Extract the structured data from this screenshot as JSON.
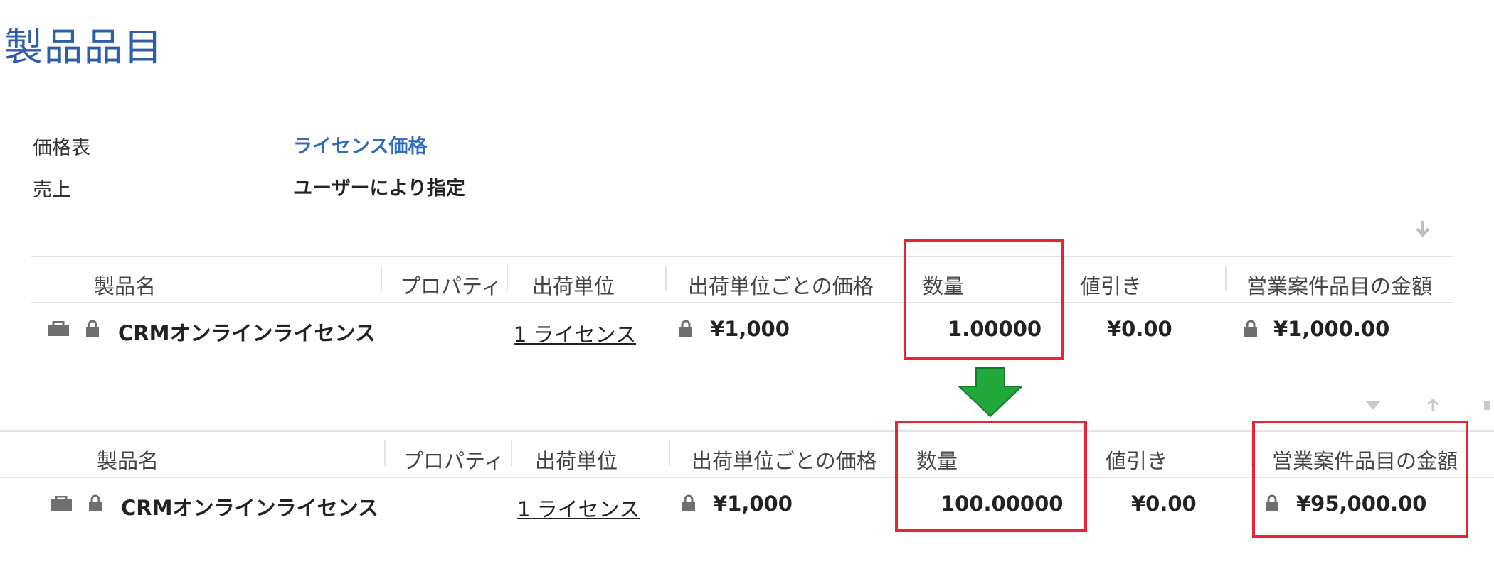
{
  "page": {
    "title": "製品品目"
  },
  "fields": {
    "price_list_label": "価格表",
    "price_list_value": "ライセンス価格",
    "revenue_label": "売上",
    "revenue_value": "ユーザーにより指定"
  },
  "columns": {
    "product_name": "製品名",
    "property": "プロパティ",
    "unit": "出荷単位",
    "price_per_unit": "出荷単位ごとの価格",
    "quantity": "数量",
    "discount": "値引き",
    "amount": "営業案件品目の金額"
  },
  "before": {
    "product_name": "CRMオンラインライセンス",
    "unit": "1 ライセンス",
    "price_per_unit": "¥1,000",
    "quantity": "1.00000",
    "discount": "¥0.00",
    "amount": "¥1,000.00"
  },
  "after": {
    "product_name": "CRMオンラインライセンス",
    "unit": "1 ライセンス",
    "price_per_unit": "¥1,000",
    "quantity": "100.00000",
    "discount": "¥0.00",
    "amount": "¥95,000.00"
  },
  "icons": {
    "product": "product-box-icon",
    "lock": "lock-icon",
    "sort": "sort-arrow-icon",
    "transition_arrow": "down-arrow-icon"
  },
  "colors": {
    "title": "#2f5ea8",
    "link": "#2f6cc0",
    "highlight": "#e52530",
    "arrow": "#21a83a",
    "icon_gray": "#6f6f6f",
    "divider": "#e3e3e3"
  }
}
